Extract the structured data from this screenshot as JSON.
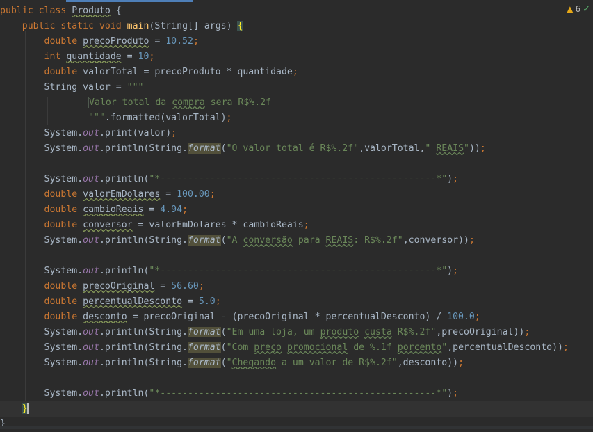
{
  "code": {
    "l1": {
      "kw1": "public",
      "kw2": "class",
      "name": "Produto",
      "brace": " {"
    },
    "l2": {
      "kw1": "public",
      "kw2": "static",
      "kw3": "void",
      "method": "main",
      "args": "(String[] args) ",
      "brace": "{"
    },
    "l3": {
      "type": "double",
      "var": "precoProduto",
      "eq": " = ",
      "num": "10.52",
      "semi": ";"
    },
    "l4": {
      "type": "int",
      "var": "quantidade",
      "eq": " = ",
      "num": "10",
      "semi": ";"
    },
    "l5": {
      "type": "double",
      "rest": "valorTotal = precoProduto * quantidade",
      "semi": ";"
    },
    "l6": {
      "text": "String valor = ",
      "str": "\"\"\""
    },
    "l7": {
      "text": "Valor total da ",
      "sq1": "compra",
      "mid": " sera R$%.2f"
    },
    "l8": {
      "str": "\"\"\"",
      "rest": ".formatted(valorTotal)",
      "semi": ";"
    },
    "l9": {
      "pre": "System.",
      "fld": "out",
      "rest": ".print(valor)",
      "semi": ";"
    },
    "l10": {
      "pre": "System.",
      "fld": "out",
      "mid": ".println(String.",
      "fmt": "format",
      "open": "(",
      "str": "\"O valor total é R$%.2f\"",
      "mid2": ",valorTotal,",
      "str2a": "\" ",
      "str2sq": "REAIS",
      "str2b": "\"",
      "end": "))",
      "semi": ";"
    },
    "l12": {
      "pre": "System.",
      "fld": "out",
      "mid": ".println(",
      "str": "\"*--------------------------------------------------*\"",
      "end": ")",
      "semi": ";"
    },
    "l13": {
      "type": "double",
      "var": "valorEmDolares",
      "eq": " = ",
      "num": "100.00",
      "semi": ";"
    },
    "l14": {
      "type": "double",
      "var": "cambioReais",
      "eq": " = ",
      "num": "4.94",
      "semi": ";"
    },
    "l15": {
      "type": "double",
      "var": "conversor",
      "rest": " = valorEmDolares * cambioReais",
      "semi": ";"
    },
    "l16": {
      "pre": "System.",
      "fld": "out",
      "mid": ".println(String.",
      "fmt": "format",
      "open": "(",
      "str1": "\"A ",
      "sq1": "conversão",
      "str2": " para ",
      "sq2": "REAIS",
      "str3": ": R$%.2f\"",
      "end": ",conversor))",
      "semi": ";"
    },
    "l18": {
      "pre": "System.",
      "fld": "out",
      "mid": ".println(",
      "str": "\"*--------------------------------------------------*\"",
      "end": ")",
      "semi": ";"
    },
    "l19": {
      "type": "double",
      "var": "precoOriginal",
      "eq": " = ",
      "num": "56.60",
      "semi": ";"
    },
    "l20": {
      "type": "double",
      "var": "percentualDesconto",
      "eq": " = ",
      "num": "5.0",
      "semi": ";"
    },
    "l21": {
      "type": "double",
      "var": "desconto",
      "rest": " = precoOriginal - (precoOriginal * percentualDesconto) / ",
      "num": "100.0",
      "semi": ";"
    },
    "l22": {
      "pre": "System.",
      "fld": "out",
      "mid": ".println(String.",
      "fmt": "format",
      "open": "(",
      "str1": "\"Em uma loja, um ",
      "sq1": "produto",
      "str2": " ",
      "sq2": "custa",
      "str3": " R$%.2f\"",
      "end": ",precoOriginal))",
      "semi": ";"
    },
    "l23": {
      "pre": "System.",
      "fld": "out",
      "mid": ".println(String.",
      "fmt": "format",
      "open": "(",
      "str1": "\"Com ",
      "sq1": "preço",
      "str2": " ",
      "sq2": "promocional",
      "str3": " de %.1f ",
      "sq3": "porcento",
      "str4": "\"",
      "end": ",percentualDesconto))",
      "semi": ";"
    },
    "l24": {
      "pre": "System.",
      "fld": "out",
      "mid": ".println(String.",
      "fmt": "format",
      "open": "(",
      "str1": "\"",
      "sq1": "Chegando",
      "str2": " a um valor de R$%.2f\"",
      "end": ",desconto))",
      "semi": ";"
    },
    "l26": {
      "pre": "System.",
      "fld": "out",
      "mid": ".println(",
      "str": "\"*--------------------------------------------------*\"",
      "end": ")",
      "semi": ";"
    },
    "l27": {
      "brace": "}"
    },
    "l28": {
      "brace": "}"
    }
  },
  "status": {
    "warnings": "6"
  },
  "colors": {
    "background": "#2b2b2b",
    "keyword": "#cc7832",
    "string": "#6a8759",
    "number": "#6897bb",
    "method": "#ffc66d",
    "field": "#9876aa"
  }
}
